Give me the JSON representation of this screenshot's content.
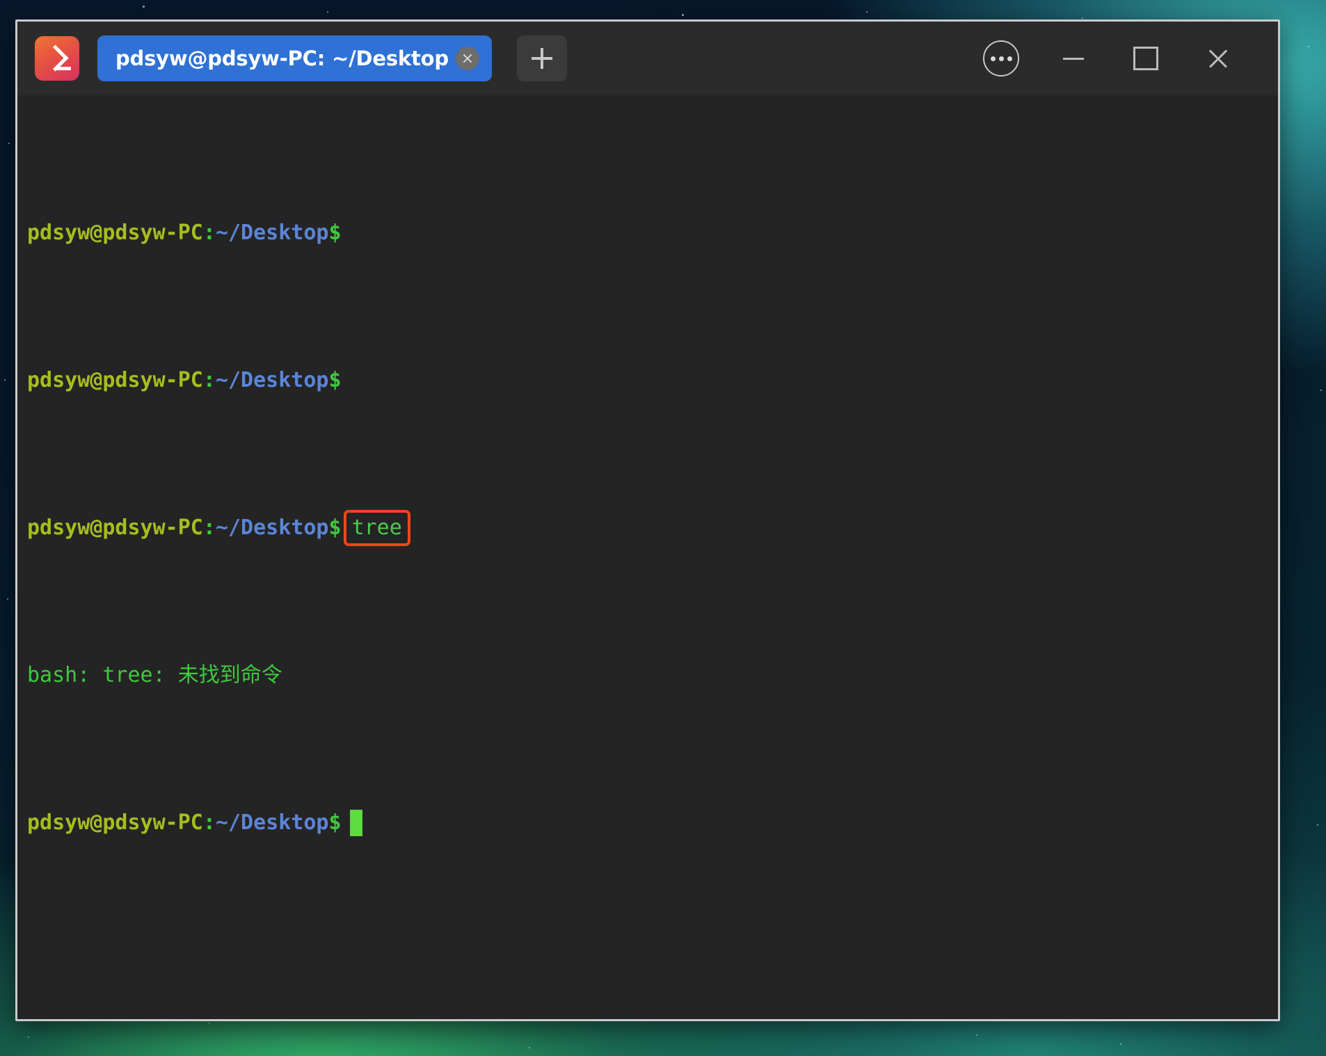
{
  "window": {
    "app_icon": "terminal-prompt-icon",
    "controls": {
      "menu_label": "⋯",
      "minimize_label": "—",
      "maximize_label": "□",
      "close_label": "✕"
    }
  },
  "tabs": [
    {
      "title": "pdsyw@pdsyw-PC: ~/Desktop",
      "active": true,
      "close_label": "×"
    }
  ],
  "new_tab": {
    "label": "+"
  },
  "terminal": {
    "prompt": {
      "userhost": "pdsyw@pdsyw-PC",
      "colon": ":",
      "path": "~/Desktop",
      "dollar": "$"
    },
    "lines": [
      {
        "type": "prompt"
      },
      {
        "type": "prompt"
      },
      {
        "type": "prompt-command",
        "command": "tree",
        "highlighted": true
      },
      {
        "type": "output",
        "text": "bash: tree: 未找到命令"
      },
      {
        "type": "prompt-cursor"
      }
    ],
    "command_entered": "tree",
    "error_message": "bash: tree: 未找到命令",
    "cursor_visible": true
  },
  "colors": {
    "titlebar": "#2b2b2b",
    "terminal_bg": "#242424",
    "tab_active": "#2f71d4",
    "prompt_userhost": "#a7bd20",
    "prompt_path": "#5c85d6",
    "prompt_symbol": "#3fc93f",
    "output_text": "#3ec93e",
    "highlight_box": "#f4441f",
    "cursor": "#5ddb3f",
    "window_border": "#c9cbcd"
  }
}
